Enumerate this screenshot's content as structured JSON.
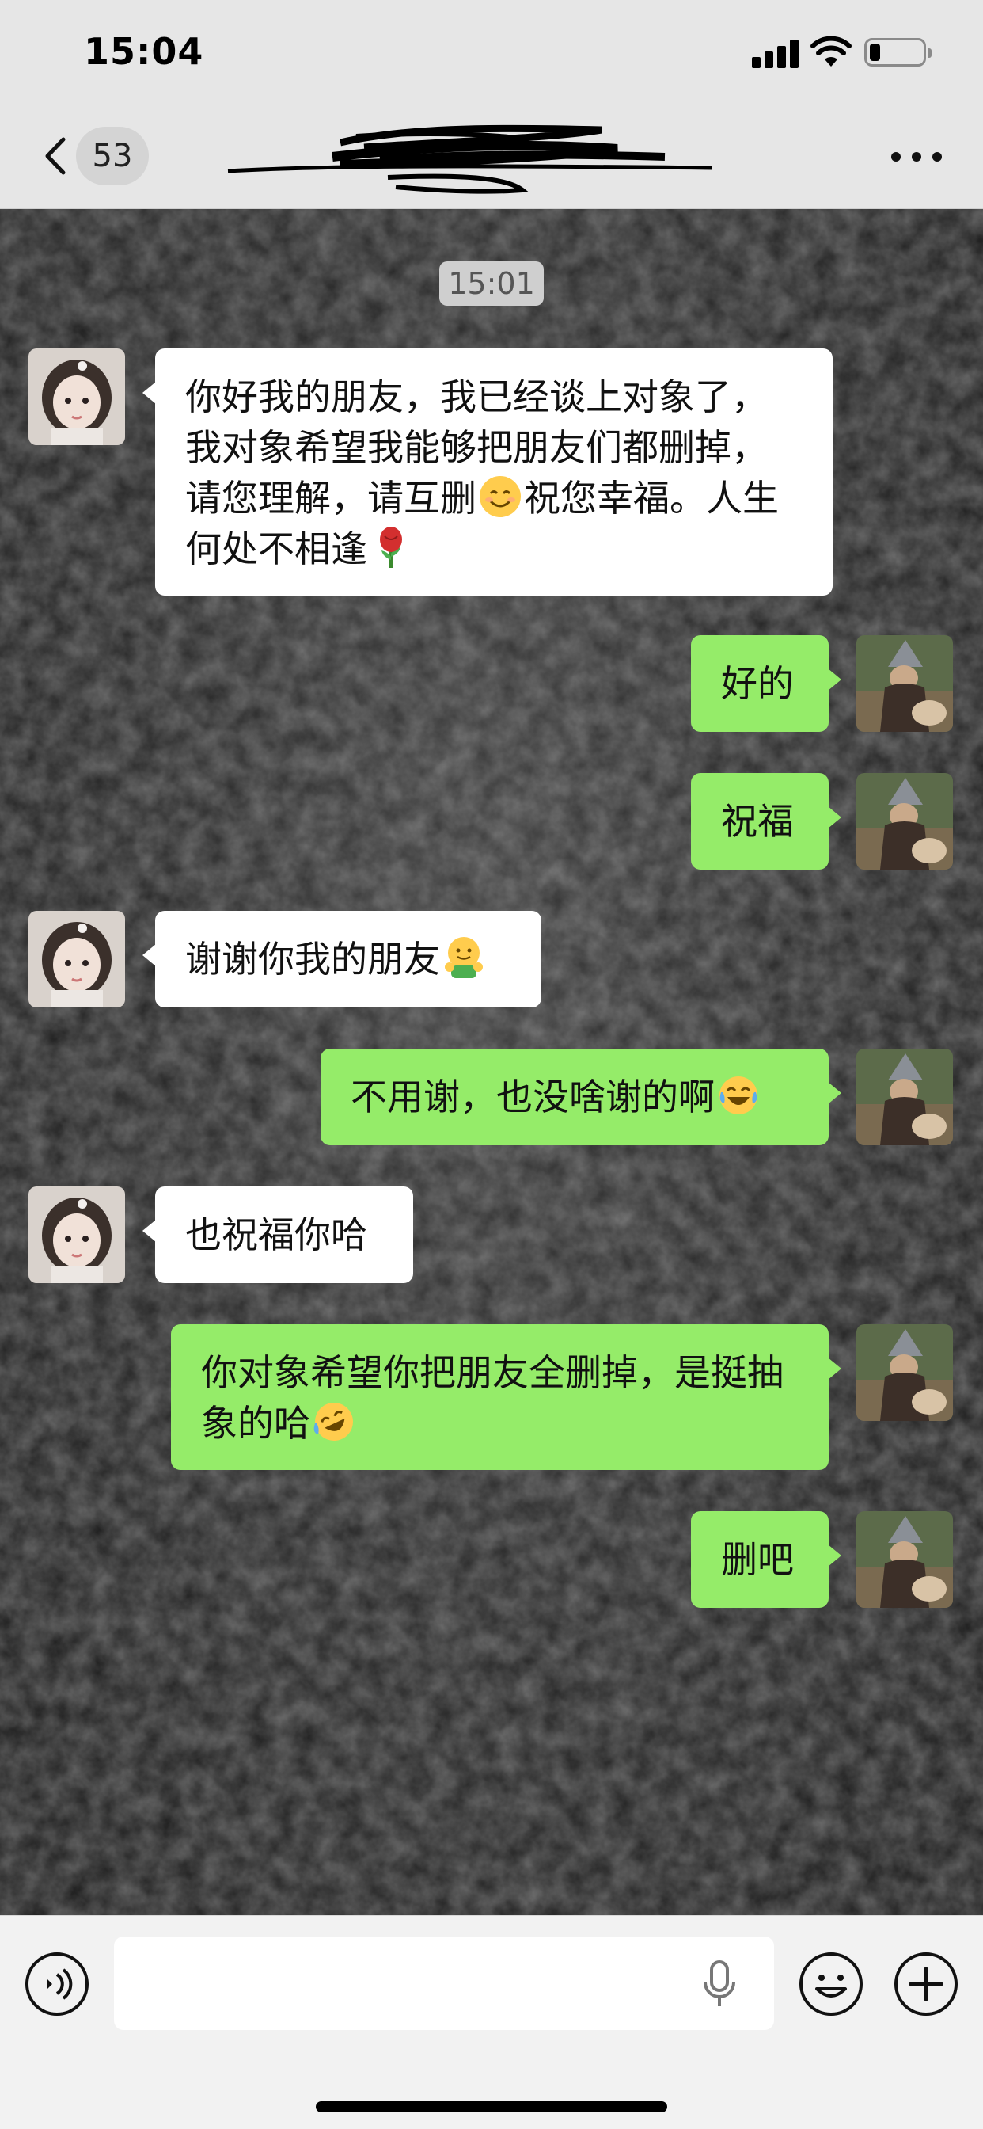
{
  "status_bar": {
    "time": "15:04",
    "battery_level": 0.2
  },
  "nav": {
    "unread_count": "53",
    "title_redacted": true,
    "more_icon": "more-dots-icon",
    "back_icon": "chevron-left-icon"
  },
  "chat": {
    "timestamp": "15:01",
    "messages": [
      {
        "side": "left",
        "text": "你好我的朋友，我已经谈上对象了，我对象希望我能够把朋友们都删掉，请您理解，请互删",
        "emoji_1": "smiling-face-emoji",
        "text_2": "祝您幸福。人生何处不相逢",
        "emoji_2": "rose-emoji"
      },
      {
        "side": "right",
        "text": "好的"
      },
      {
        "side": "right",
        "text": "祝福"
      },
      {
        "side": "left",
        "text": "谢谢你我的朋友",
        "emoji_1": "hugging-face-emoji"
      },
      {
        "side": "right",
        "text": "不用谢，也没啥谢的啊",
        "emoji_1": "tears-of-joy-emoji"
      },
      {
        "side": "left",
        "text": "也祝福你哈"
      },
      {
        "side": "right",
        "text": "你对象希望你把朋友全删掉，是挺抽象的哈",
        "emoji_1": "rolling-laughing-emoji"
      },
      {
        "side": "right",
        "text": "删吧"
      }
    ]
  },
  "input_bar": {
    "voice_icon": "voice-mode-icon",
    "mic_icon": "microphone-icon",
    "emoji_icon": "emoji-face-icon",
    "plus_icon": "plus-circle-icon",
    "input_value": ""
  },
  "colors": {
    "bubble_green": "#95ec69",
    "bubble_white": "#ffffff",
    "nav_bg": "#e6e6e6"
  }
}
